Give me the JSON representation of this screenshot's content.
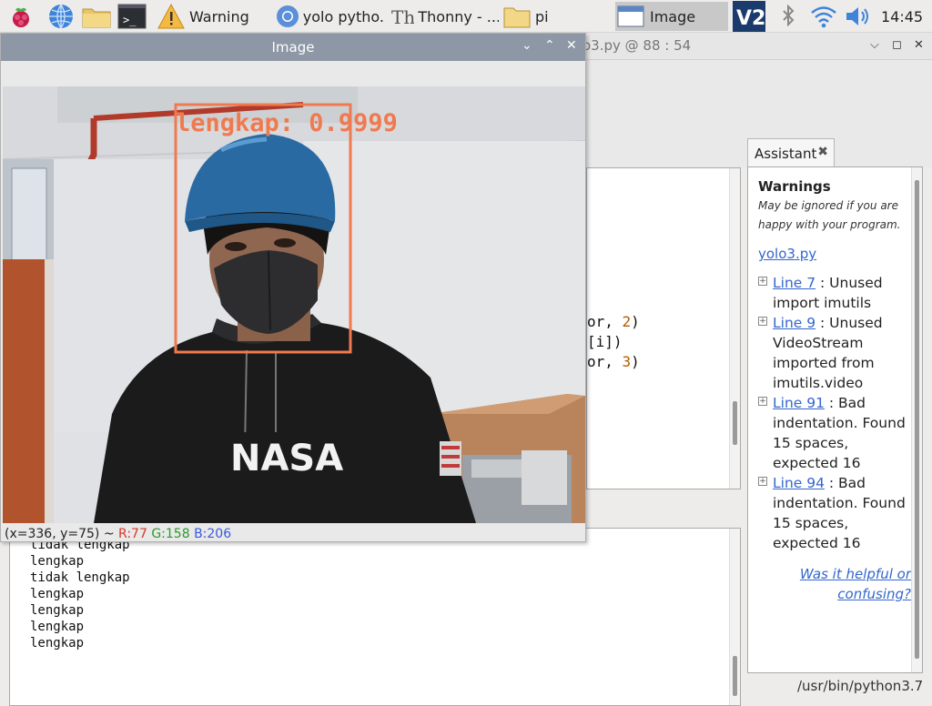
{
  "taskbar": {
    "tasks": [
      {
        "label": "Warning",
        "icon": "warning-icon"
      },
      {
        "label": "yolo pytho...",
        "icon": "chromium-icon"
      },
      {
        "label": "Thonny  -  ...",
        "icon": "thonny-icon"
      },
      {
        "label": "pi",
        "icon": "folder-icon"
      },
      {
        "label": "Image",
        "icon": "window-icon"
      }
    ],
    "clock": "14:45",
    "launchers": [
      "raspberry-menu-icon",
      "web-browser-icon",
      "file-manager-icon",
      "terminal-icon"
    ],
    "tray": [
      "vnc-icon",
      "bluetooth-icon",
      "wifi-icon",
      "volume-icon"
    ]
  },
  "thonny": {
    "title_partial": "o3.py  @  88 : 54",
    "editor_fragments": [
      "or, ",
      "2",
      ")",
      "[i])",
      "or, ",
      "3",
      ")"
    ],
    "shell_lines": [
      "tidak lengkap",
      "lengkap",
      "tidak lengkap",
      "lengkap",
      "lengkap",
      "lengkap",
      "lengkap"
    ],
    "status": "/usr/bin/python3.7"
  },
  "assistant": {
    "tab_label": "Assistant",
    "heading": "Warnings",
    "subtitle": "May be ignored if you are happy with your program.",
    "file_link": "yolo3.py",
    "warnings": [
      {
        "line": "Line 7",
        "text": ": Unused import imutils"
      },
      {
        "line": "Line 9",
        "text": ": Unused VideoStream imported from imutils.video"
      },
      {
        "line": "Line 91",
        "text": ": Bad indentation. Found 15 spaces, expected 16"
      },
      {
        "line": "Line 94",
        "text": ": Bad indentation. Found 15 spaces, expected 16"
      }
    ],
    "help_link": "Was it helpful or confusing?"
  },
  "image_window": {
    "title": "Image",
    "detection_label": "lengkap: 0.9999",
    "shirt_text": "NASA",
    "pixel_info": {
      "coords": "(x=336, y=75) ~ ",
      "r": "R:77",
      "g": "G:158",
      "b": "B:206"
    },
    "colors": {
      "box": "#f07a50",
      "r": "#d43a2a",
      "g": "#2a9a2a",
      "b": "#3a5adc"
    }
  }
}
